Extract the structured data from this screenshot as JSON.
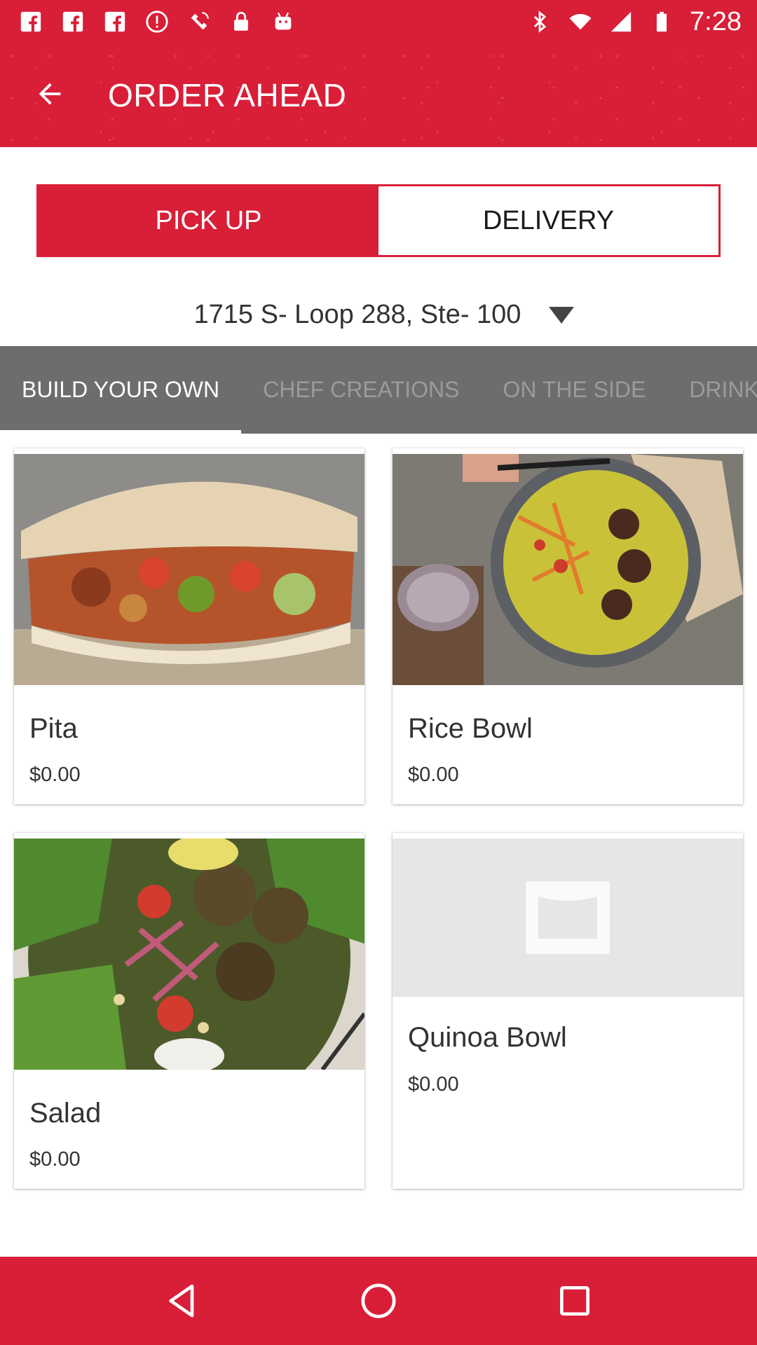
{
  "status_bar": {
    "time": "7:28",
    "icons": [
      "facebook-icon",
      "facebook-icon",
      "facebook-icon",
      "alert-icon",
      "satellite-icon",
      "lock-icon",
      "android-icon"
    ],
    "right_icons": [
      "bluetooth-icon",
      "wifi-icon",
      "signal-icon",
      "battery-icon"
    ]
  },
  "app_bar": {
    "title": "ORDER AHEAD",
    "back_icon": "arrow-back-icon"
  },
  "order_type": {
    "pickup_label": "PICK UP",
    "delivery_label": "DELIVERY",
    "selected": "PICK UP"
  },
  "location": {
    "address": "1715 S- Loop 288, Ste- 100"
  },
  "tabs": [
    {
      "label": "BUILD YOUR OWN",
      "active": true
    },
    {
      "label": "CHEF CREATIONS",
      "active": false
    },
    {
      "label": "ON THE SIDE",
      "active": false
    },
    {
      "label": "DRINKS",
      "active": false
    }
  ],
  "menu_items": [
    {
      "name": "Pita",
      "price": "$0.00"
    },
    {
      "name": "Rice Bowl",
      "price": "$0.00"
    },
    {
      "name": "Salad",
      "price": "$0.00"
    },
    {
      "name": "Quinoa Bowl",
      "price": "$0.00"
    }
  ],
  "colors": {
    "brand_red": "#d91e38",
    "tab_bar": "#6e6d6c"
  },
  "nav_bar": {
    "icons": [
      "back-triangle-icon",
      "home-circle-icon",
      "recents-square-icon"
    ]
  }
}
